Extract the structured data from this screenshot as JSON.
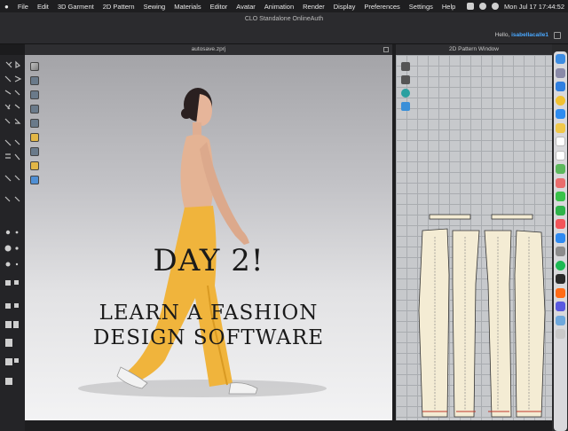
{
  "menubar": {
    "items": [
      "File",
      "Edit",
      "3D Garment",
      "2D Pattern",
      "Sewing",
      "Materials",
      "Editor",
      "Avatar",
      "Animation",
      "Render",
      "Display",
      "Preferences",
      "Settings",
      "Help"
    ],
    "clock": "Mon Jul 17  17:44:52"
  },
  "app": {
    "title": "CLO Standalone OnlineAuth",
    "greeting": "Hello,",
    "username": "isabellacalle1"
  },
  "panels": {
    "viewport_title": "autosave.zprj",
    "pattern_title": "2D Pattern Window"
  },
  "overlay": {
    "line1": "DAY 2!",
    "line2": "LEARN A FASHION",
    "line3": "DESIGN SOFTWARE"
  },
  "colors": {
    "accent": "#4aa8ff",
    "garment": "#f0b43c",
    "pattern_fill": "#f4ecd4",
    "skin": "#e6b59a"
  },
  "icons": {
    "menubar_right": [
      "control-center-icon",
      "focus-icon",
      "clock-icon"
    ],
    "dock": [
      "finder-icon",
      "launchpad-icon",
      "safari-icon",
      "chrome-icon",
      "mail-icon",
      "notes-icon",
      "calendar-icon",
      "reminders-icon",
      "maps-icon",
      "photos-icon",
      "messages-icon",
      "facetime-icon",
      "music-icon",
      "app-store-icon",
      "system-settings-icon",
      "spotify-icon",
      "clo-icon",
      "illustrator-icon",
      "photoshop-icon",
      "preview-icon",
      "trash-icon"
    ]
  }
}
